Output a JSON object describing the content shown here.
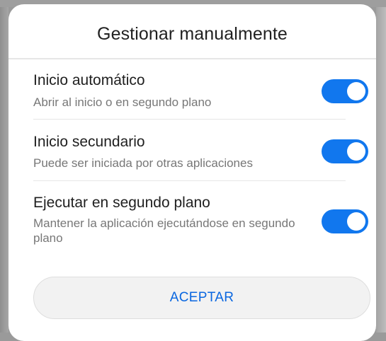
{
  "dialog": {
    "title": "Gestionar manualmente",
    "options": [
      {
        "title": "Inicio automático",
        "description": "Abrir al inicio o en segundo plano",
        "enabled": true
      },
      {
        "title": "Inicio secundario",
        "description": "Puede ser iniciada por otras aplicaciones",
        "enabled": true
      },
      {
        "title": "Ejecutar en segundo plano",
        "description": "Mantener la aplicación ejecutándose en segundo plano",
        "enabled": true
      }
    ],
    "accept_label": "ACEPTAR"
  },
  "colors": {
    "accent": "#1177ee",
    "button_text": "#0a67e0",
    "overlay": "#9a9a9a"
  }
}
